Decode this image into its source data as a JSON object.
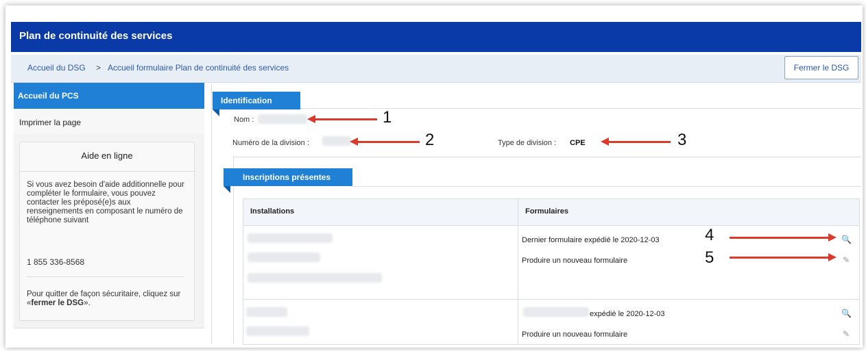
{
  "app": {
    "title": "Plan de continuité des services"
  },
  "breadcrumb": {
    "home": "Accueil du DSG",
    "separator": ">",
    "current": "Accueil formulaire Plan de continuité des services"
  },
  "header": {
    "close_label": "Fermer le DSG"
  },
  "sidebar": {
    "active_item": "Accueil du PCS",
    "print_item": "Imprimer la page",
    "help": {
      "title": "Aide en ligne",
      "text": "Si vous avez besoin d'aide additionnelle pour compléter le formulaire, vous pouvez contacter les préposé(e)s aux renseignements en composant le numéro de téléphone suivant",
      "phone": "1 855 336-8568",
      "quit_prefix": "Pour quitter de façon sécuritaire, cliquez sur «",
      "quit_link": "fermer le DSG",
      "quit_suffix": "»."
    }
  },
  "identification": {
    "tab_label": "Identification",
    "name_label": "Nom :",
    "division_number_label": "Numéro de la division :",
    "division_type_label": "Type de division :",
    "division_type_value": "CPE"
  },
  "inscriptions": {
    "tab_label": "Inscriptions présentes",
    "columns": [
      "Installations",
      "Formulaires"
    ],
    "rows": [
      {
        "last_form": "Dernier formulaire expédié le 2020-12-03",
        "new_form": "Produire un nouveau formulaire"
      },
      {
        "last_form": "expédié le 2020-12-03",
        "new_form": "Produire un nouveau formulaire"
      }
    ]
  },
  "annotations": {
    "numbers": [
      "1",
      "2",
      "3",
      "4",
      "5"
    ]
  },
  "colors": {
    "title_bar": "#0a3aa8",
    "accent": "#1f80d6",
    "annotation_arrow": "#d93a2a",
    "link": "#2b5aa5"
  },
  "icons": {
    "view_form": "document-view-icon",
    "edit_form": "pencil-icon"
  }
}
